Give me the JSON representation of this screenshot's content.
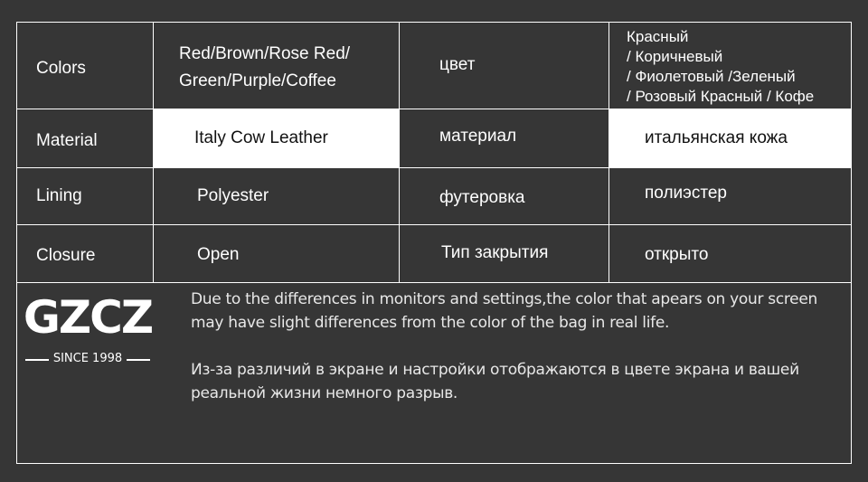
{
  "table": {
    "rows": [
      {
        "label_en": "Colors",
        "value_en": "Red/Brown/Rose Red/\nGreen/Purple/Coffee",
        "label_ru": "цвет",
        "value_ru": "Красный\n/ Коричневый\n/ Фиолетовый /Зеленый\n/ Розовый Красный / Кофе"
      },
      {
        "label_en": "Material",
        "value_en": "Italy Cow Leather",
        "label_ru": "материал",
        "value_ru": "итальянская кожа"
      },
      {
        "label_en": "Lining",
        "value_en": "Polyester",
        "label_ru": "футеровка",
        "value_ru": "полиэстер"
      },
      {
        "label_en": "Closure",
        "value_en": "Open",
        "label_ru": "Тип закрытия",
        "value_ru": "открыто"
      }
    ]
  },
  "brand": {
    "name": "GZCZ",
    "tagline": "SINCE 1998"
  },
  "note": {
    "en": "Due to the differences in monitors and settings,the color that apears on your screen may have slight differences from the color of the bag in real life.",
    "ru": "Из-за различий в экране и настройки отображаются в цвете экрана и вашей реальной жизни немного разрыв."
  }
}
